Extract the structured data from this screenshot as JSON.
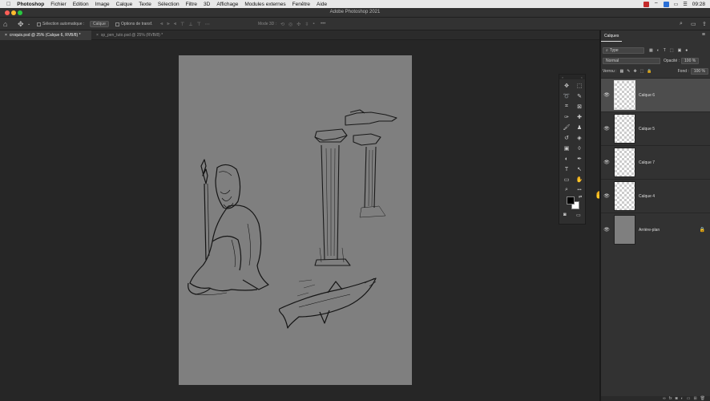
{
  "menubar": {
    "apple": "",
    "app_name": "Photoshop",
    "items": [
      "Fichier",
      "Edition",
      "Image",
      "Calque",
      "Texte",
      "Sélection",
      "Filtre",
      "3D",
      "Affichage",
      "Modules externes",
      "Fenêtre",
      "Aide"
    ],
    "clock": "09:28",
    "colors": {
      "red_icon": "#c42b2b",
      "blue_icon": "#2a6fd6"
    }
  },
  "window": {
    "title": "Adobe Photoshop 2021",
    "traffic_lights": {
      "close": "#ff5f57",
      "minimize": "#febc2e",
      "maximize": "#28c840"
    }
  },
  "options_bar": {
    "home_icon": "home-icon",
    "move_icon": "move-tool-icon",
    "auto_select_label": "Sélection automatique :",
    "auto_select_value": "Calque",
    "transform_label": "Options de transf.",
    "mode_3d_label": "Mode 3D :"
  },
  "tabs": [
    {
      "label": "croquis.psd @ 25% (Calque 6, RVB/8) *",
      "close": "×",
      "active": true
    },
    {
      "label": "sp_pen_tuto.psd @ 25% (RVB/8) *",
      "close": "×",
      "active": false
    }
  ],
  "toolbox": {
    "tools": [
      {
        "glyph": "✥",
        "name": "move-tool-icon"
      },
      {
        "glyph": "⬚",
        "name": "marquee-tool-icon"
      },
      {
        "glyph": "➰",
        "name": "lasso-tool-icon"
      },
      {
        "glyph": "✎",
        "name": "quick-select-tool-icon"
      },
      {
        "glyph": "⌗",
        "name": "crop-tool-icon"
      },
      {
        "glyph": "⊠",
        "name": "frame-tool-icon"
      },
      {
        "glyph": "✑",
        "name": "eyedropper-tool-icon"
      },
      {
        "glyph": "✚",
        "name": "healing-tool-icon"
      },
      {
        "glyph": "🖌",
        "name": "brush-tool-icon"
      },
      {
        "glyph": "♟",
        "name": "stamp-tool-icon"
      },
      {
        "glyph": "↺",
        "name": "history-brush-icon"
      },
      {
        "glyph": "◈",
        "name": "eraser-tool-icon"
      },
      {
        "glyph": "▣",
        "name": "gradient-tool-icon"
      },
      {
        "glyph": "◊",
        "name": "blur-tool-icon"
      },
      {
        "glyph": "◐",
        "name": "dodge-tool-icon"
      },
      {
        "glyph": "✒",
        "name": "pen-tool-icon"
      },
      {
        "glyph": "T",
        "name": "type-tool-icon"
      },
      {
        "glyph": "↖",
        "name": "path-select-tool-icon"
      },
      {
        "glyph": "▭",
        "name": "shape-tool-icon"
      },
      {
        "glyph": "✋",
        "name": "hand-tool-icon"
      },
      {
        "glyph": "⌕",
        "name": "zoom-tool-icon"
      },
      {
        "glyph": "•••",
        "name": "more-tools-icon"
      }
    ],
    "foreground_color": "#000000",
    "background_color": "#ffffff"
  },
  "layers_panel": {
    "tab_label": "Calques",
    "filter_value": "Type",
    "blend_mode": "Normal",
    "opacity_label": "Opacité :",
    "opacity_value": "100 %",
    "lock_label": "Verrou :",
    "fill_label": "Fond :",
    "fill_value": "100 %",
    "layers": [
      {
        "name": "Calque 6",
        "selected": true,
        "visible": true,
        "background": false
      },
      {
        "name": "Calque 5",
        "selected": false,
        "visible": true,
        "background": false
      },
      {
        "name": "Calque 7",
        "selected": false,
        "visible": true,
        "background": false
      },
      {
        "name": "Calque 4",
        "selected": false,
        "visible": true,
        "background": false
      },
      {
        "name": "Arrière-plan",
        "selected": false,
        "visible": true,
        "background": true
      }
    ],
    "canvas_color": "#7f7f7f"
  }
}
